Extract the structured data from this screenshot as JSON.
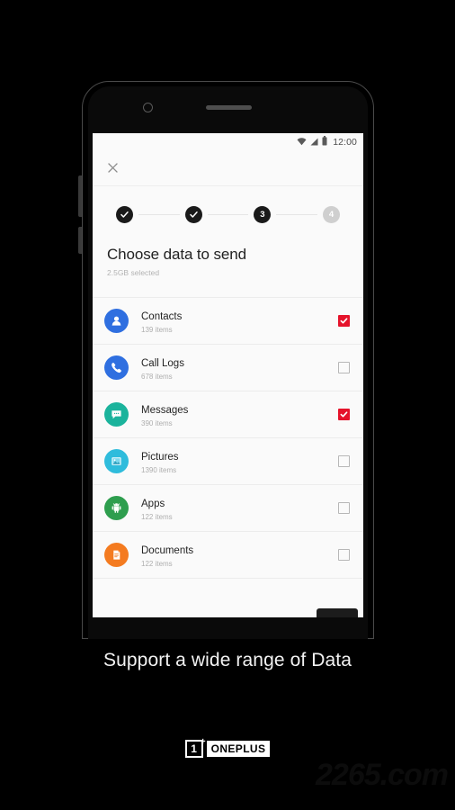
{
  "promo": {
    "caption": "Support a wide range of Data",
    "brand_mark": "1",
    "brand_plus": "+",
    "brand_word": "ONEPLUS",
    "watermark": "2265.com"
  },
  "phone": {
    "statusbar": {
      "wifi_icon": "wifi-icon",
      "signal_icon": "signal-icon",
      "battery_icon": "battery-icon",
      "time": "12:00"
    },
    "toolbar": {
      "close_icon": "close-icon"
    },
    "stepper": {
      "steps": [
        {
          "label": "",
          "state": "done",
          "icon": "check-icon"
        },
        {
          "label": "",
          "state": "done",
          "icon": "check-icon"
        },
        {
          "label": "3",
          "state": "current",
          "icon": ""
        },
        {
          "label": "4",
          "state": "upcoming",
          "icon": ""
        }
      ]
    },
    "heading": {
      "title": "Choose data to send",
      "subtitle": "2.5GB selected"
    },
    "list": {
      "items": [
        {
          "label": "Contacts",
          "count": "139 items",
          "icon": "contacts-icon",
          "color": "#2f6fe0",
          "checked": true
        },
        {
          "label": "Call Logs",
          "count": "678 items",
          "icon": "phone-icon",
          "color": "#2f6fe0",
          "checked": false
        },
        {
          "label": "Messages",
          "count": "390 items",
          "icon": "message-icon",
          "color": "#1bb39c",
          "checked": true
        },
        {
          "label": "Pictures",
          "count": "1390 items",
          "icon": "picture-icon",
          "color": "#2fbcdc",
          "checked": false
        },
        {
          "label": "Apps",
          "count": "122 items",
          "icon": "android-icon",
          "color": "#2e9e4e",
          "checked": false
        },
        {
          "label": "Documents",
          "count": "122 items",
          "icon": "document-icon",
          "color": "#f47b20",
          "checked": false
        }
      ]
    },
    "next_button": {
      "label": ""
    }
  },
  "colors": {
    "accent_red": "#e5132b",
    "step_active": "#1a1a1a",
    "step_inactive": "#cfcfcf",
    "screen_bg": "#fafafa"
  }
}
